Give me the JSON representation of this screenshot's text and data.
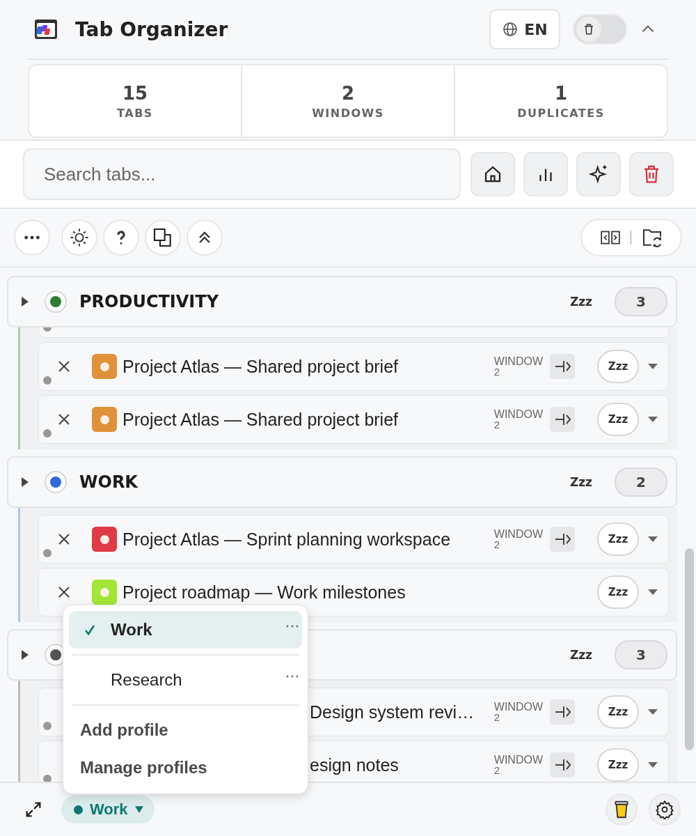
{
  "header": {
    "title": "Tab Organizer",
    "language": "EN",
    "toggle_on": false
  },
  "stats": [
    {
      "value": "15",
      "label": "TABS"
    },
    {
      "value": "2",
      "label": "WINDOWS"
    },
    {
      "value": "1",
      "label": "DUPLICATES"
    }
  ],
  "search": {
    "placeholder": "Search tabs..."
  },
  "groups": [
    {
      "title": "PRODUCTIVITY",
      "color": "#2e7d32",
      "sleep_label": "Zzz",
      "count": "3",
      "tabs": [
        {
          "kind": "full",
          "title": "Project Atlas — Shared project brief",
          "color": "#e0913a",
          "window_label": "WINDOW",
          "window_number": "2",
          "sleep_label": "Zzz",
          "loaded": true
        },
        {
          "kind": "full",
          "title": "Project Atlas — Shared project brief",
          "color": "#e0913a",
          "window_label": "WINDOW",
          "window_number": "2",
          "sleep_label": "Zzz",
          "loaded": true
        }
      ]
    },
    {
      "title": "WORK",
      "color": "#2f6bd8",
      "sleep_label": "Zzz",
      "count": "2",
      "tabs": [
        {
          "kind": "full",
          "title": "Project Atlas — Sprint planning workspace",
          "color": "#e03a45",
          "window_label": "WINDOW",
          "window_number": "2",
          "sleep_label": "Zzz",
          "loaded": true
        },
        {
          "kind": "full",
          "title": "Project roadmap — Work milestones",
          "color": "#a3e635",
          "sleep_label": "Zzz",
          "loaded": false
        }
      ]
    },
    {
      "color": "#555555",
      "sleep_label": "Zzz",
      "count": "3",
      "tabs": [
        {
          "kind": "covered",
          "title": "Design system revi…",
          "window_label": "WINDOW",
          "window_number": "2",
          "sleep_label": "Zzz",
          "loaded": true
        },
        {
          "kind": "covered",
          "title": "esign notes",
          "window_label": "WINDOW",
          "window_number": "2",
          "sleep_label": "Zzz",
          "loaded": true
        }
      ]
    }
  ],
  "footer": {
    "profile": "Work"
  },
  "profile_menu": {
    "profiles": [
      {
        "name": "Work",
        "selected": true
      },
      {
        "name": "Research",
        "selected": false
      }
    ],
    "actions": [
      "Add profile",
      "Manage profiles"
    ]
  }
}
